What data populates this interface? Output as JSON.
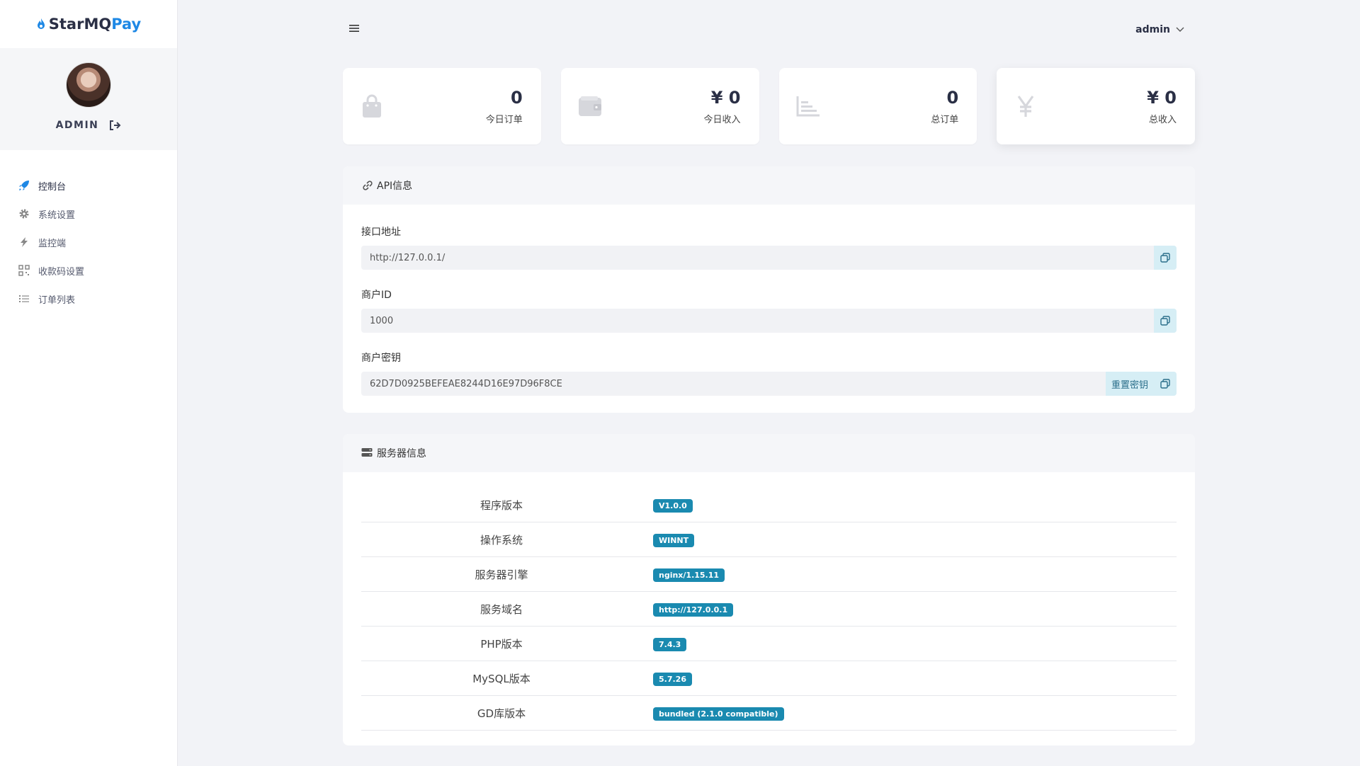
{
  "brand": {
    "prefix": "StarMQ",
    "suffix": "Pay"
  },
  "profile": {
    "name": "ADMIN"
  },
  "nav": [
    {
      "label": "控制台",
      "icon": "rocket-icon"
    },
    {
      "label": "系统设置",
      "icon": "gear-icon"
    },
    {
      "label": "监控端",
      "icon": "lightning-icon"
    },
    {
      "label": "收款码设置",
      "icon": "qr-grid-icon"
    },
    {
      "label": "订单列表",
      "icon": "list-icon"
    }
  ],
  "topbar": {
    "user": "admin"
  },
  "stats": [
    {
      "value": "0",
      "label": "今日订单",
      "icon": "shopping-bag-icon"
    },
    {
      "value": "¥ 0",
      "label": "今日收入",
      "icon": "wallet-icon"
    },
    {
      "value": "0",
      "label": "总订单",
      "icon": "bar-chart-icon"
    },
    {
      "value": "¥ 0",
      "label": "总收入",
      "icon": "yen-icon"
    }
  ],
  "api": {
    "title": "API信息",
    "endpoint_label": "接口地址",
    "endpoint_value": "http://127.0.0.1/",
    "merchant_id_label": "商户ID",
    "merchant_id_value": "1000",
    "merchant_key_label": "商户密钥",
    "merchant_key_value": "62D7D0925BEFEAE8244D16E97D96F8CE",
    "reset_label": "重置密钥"
  },
  "server": {
    "title": "服务器信息",
    "rows": [
      {
        "key": "程序版本",
        "value": "V1.0.0"
      },
      {
        "key": "操作系统",
        "value": "WINNT"
      },
      {
        "key": "服务器引擎",
        "value": "nginx/1.15.11"
      },
      {
        "key": "服务域名",
        "value": "http://127.0.0.1"
      },
      {
        "key": "PHP版本",
        "value": "7.4.3"
      },
      {
        "key": "MySQL版本",
        "value": "5.7.26"
      },
      {
        "key": "GD库版本",
        "value": "bundled (2.1.0 compatible)"
      }
    ]
  },
  "colors": {
    "accent": "#1e88e5",
    "badge": "#1a8ab0",
    "copy_bg": "#d6eef5"
  }
}
